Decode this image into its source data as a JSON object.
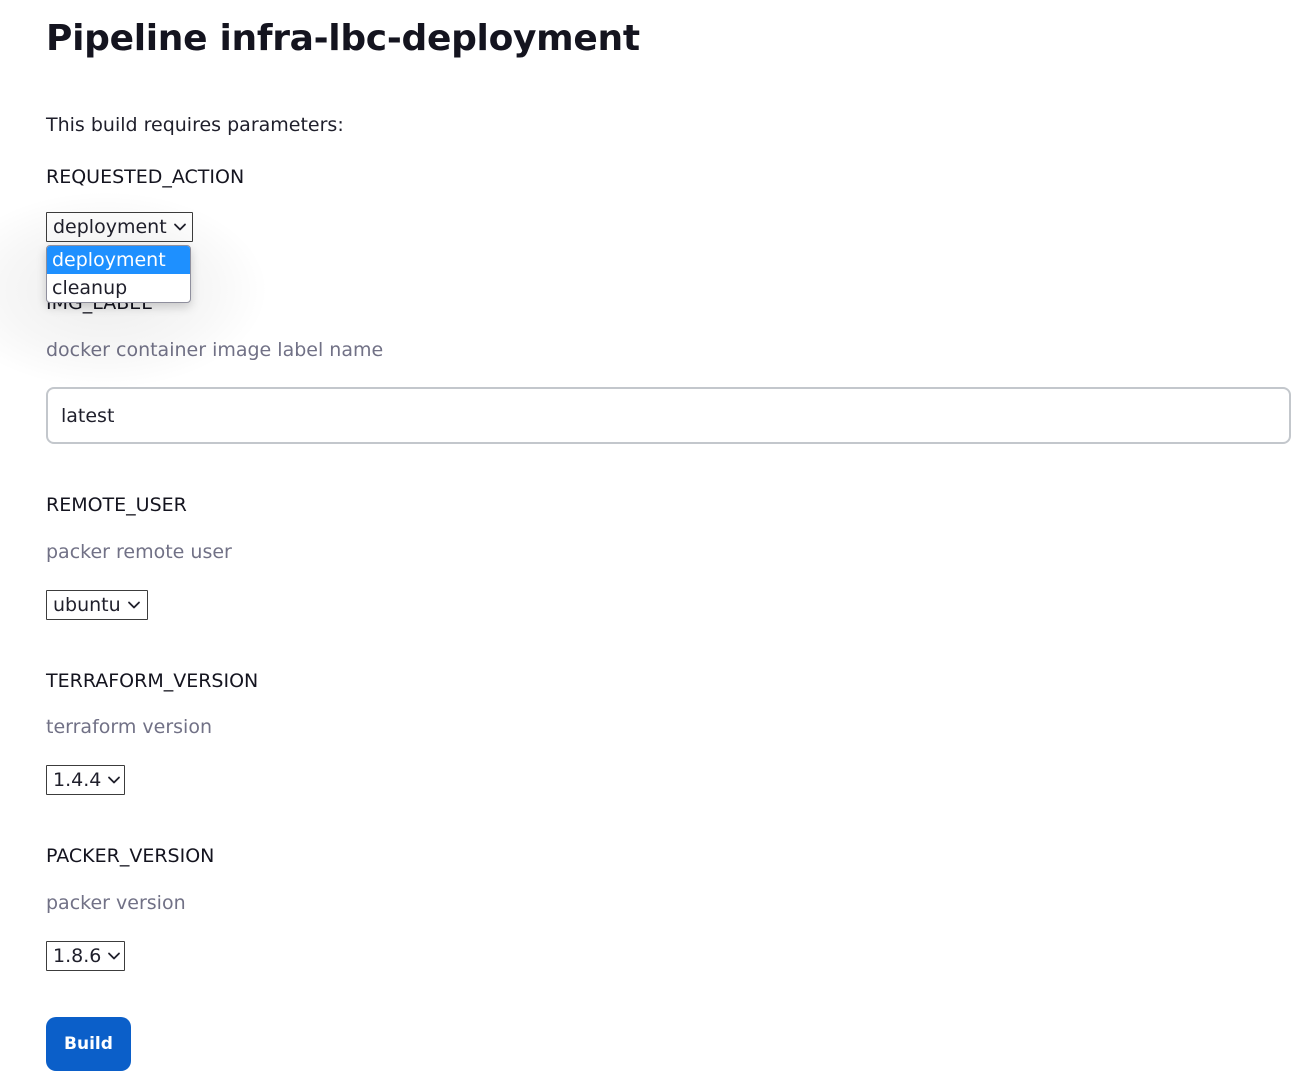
{
  "page": {
    "title": "Pipeline infra-lbc-deployment",
    "intro": "This build requires parameters:"
  },
  "params": {
    "requested_action": {
      "name": "REQUESTED_ACTION",
      "selected": "deployment",
      "options": [
        "deployment",
        "cleanup"
      ],
      "highlighted_option": "deployment"
    },
    "img_label": {
      "name": "IMG_LABEL",
      "description": "docker container image label name",
      "value": "latest"
    },
    "remote_user": {
      "name": "REMOTE_USER",
      "description": "packer remote user",
      "selected": "ubuntu"
    },
    "terraform_version": {
      "name": "TERRAFORM_VERSION",
      "description": "terraform version",
      "selected": "1.4.4"
    },
    "packer_version": {
      "name": "PACKER_VERSION",
      "description": "packer version",
      "selected": "1.8.6"
    }
  },
  "actions": {
    "build_label": "Build"
  },
  "icons": {
    "select_chevron": "chevron-down-icon"
  },
  "colors": {
    "primary_button": "#0b5fc9",
    "option_highlight": "#1e90ff",
    "description_text": "#717186"
  }
}
